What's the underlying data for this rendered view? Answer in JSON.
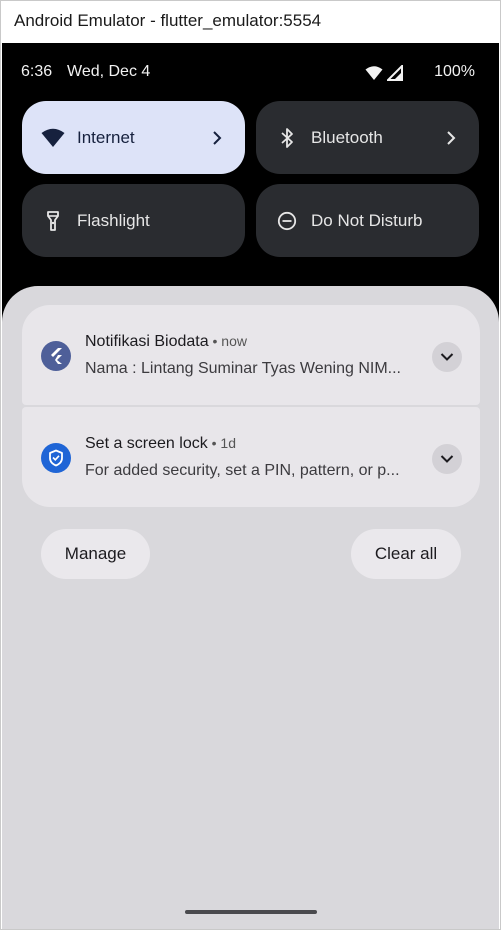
{
  "window": {
    "title": "Android Emulator - flutter_emulator:5554"
  },
  "status_bar": {
    "time": "6:36",
    "date": "Wed, Dec 4",
    "battery": "100%",
    "icons": [
      "wifi-icon",
      "signal-icon"
    ]
  },
  "quick_settings": {
    "tiles": [
      {
        "label": "Internet",
        "icon": "wifi-icon",
        "state": "on",
        "has_chevron": true
      },
      {
        "label": "Bluetooth",
        "icon": "bluetooth-icon",
        "state": "off",
        "has_chevron": true
      },
      {
        "label": "Flashlight",
        "icon": "flashlight-icon",
        "state": "off",
        "has_chevron": false
      },
      {
        "label": "Do Not Disturb",
        "icon": "do-not-disturb-icon",
        "state": "off",
        "has_chevron": false
      }
    ]
  },
  "notifications": [
    {
      "title": "Notifikasi Biodata",
      "time": " • now",
      "body": "Nama : Lintang Suminar Tyas Wening NIM...",
      "icon": "flutter-icon"
    },
    {
      "title": "Set a screen lock",
      "time": " • 1d",
      "body": "For added security, set a PIN, pattern, or p...",
      "icon": "shield-icon"
    }
  ],
  "actions": {
    "manage": "Manage",
    "clear_all": "Clear all"
  },
  "colors": {
    "active_tile": "#dde3f8",
    "inactive_tile": "#2a2c30",
    "shade": "#d9d8dc",
    "notification": "#e8e6ea",
    "flutter_icon_bg": "#4e5f99",
    "shield_icon_bg": "#1f65d6"
  }
}
